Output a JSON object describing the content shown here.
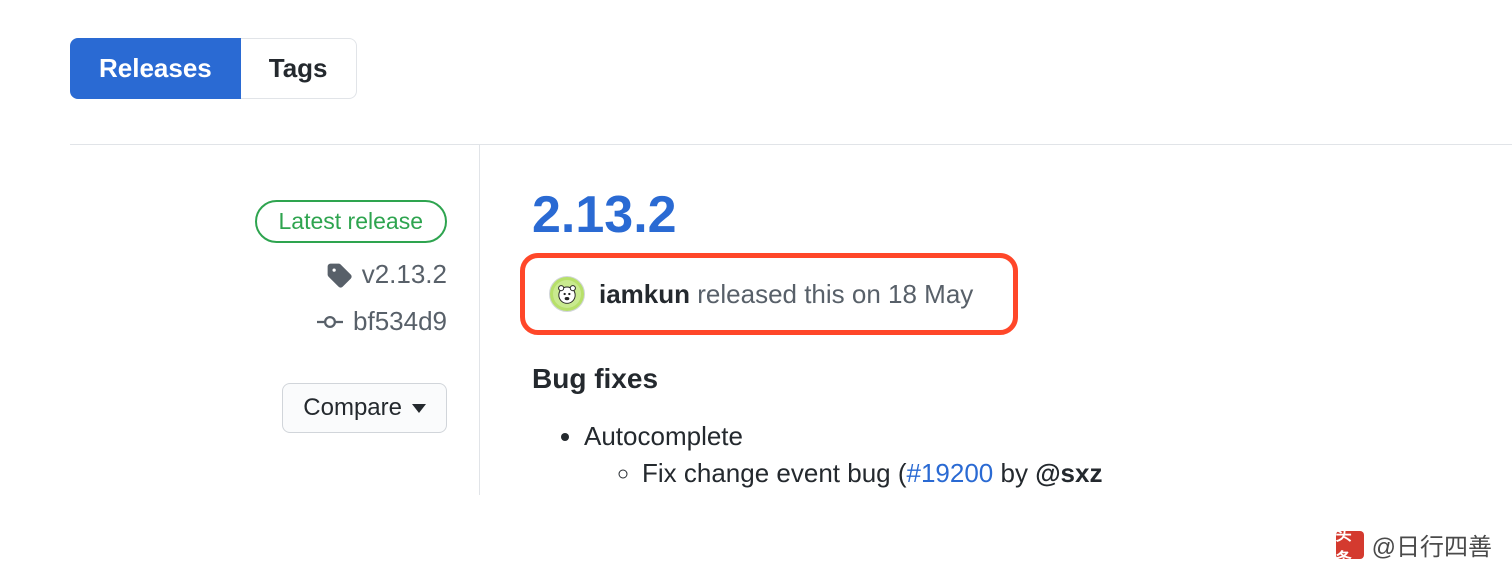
{
  "tabs": {
    "releases": "Releases",
    "tags": "Tags"
  },
  "sidebar": {
    "latest_label": "Latest release",
    "tag_name": "v2.13.2",
    "commit_sha": "bf534d9",
    "compare_label": "Compare"
  },
  "release": {
    "title": "2.13.2",
    "author": "iamkun",
    "released_text": " released this on 18 May",
    "section_heading": "Bug fixes",
    "items": [
      {
        "label": "Autocomplete",
        "subitems": [
          {
            "prefix": "Fix change event bug (",
            "issue": "#19200",
            "by_text": " by ",
            "by_user": "@sxz"
          }
        ]
      }
    ]
  },
  "watermark": {
    "logo_text": "头条",
    "text": "@日行四善"
  }
}
